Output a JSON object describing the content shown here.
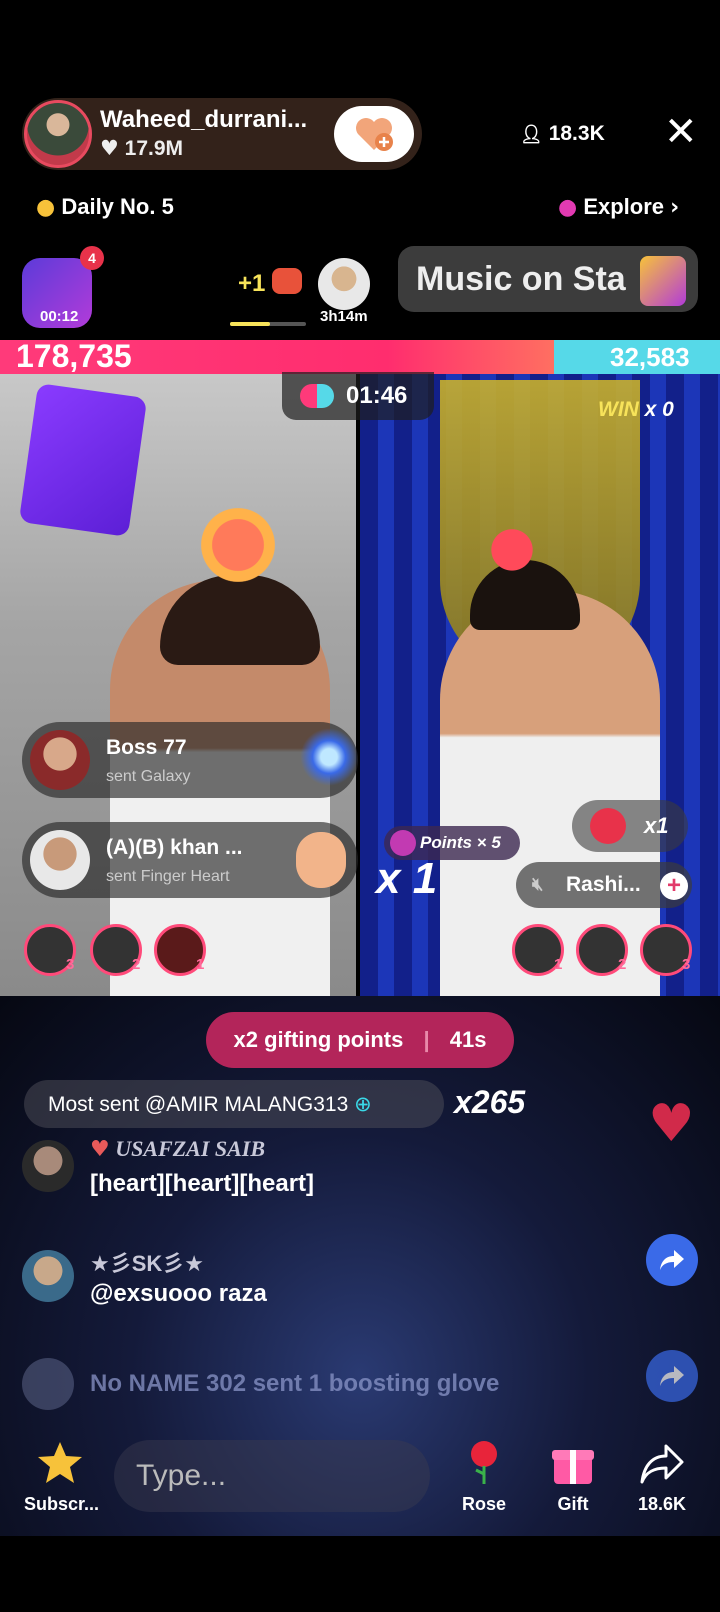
{
  "host": {
    "name": "Waheed_durrani...",
    "likes": "17.9M",
    "viewers": "18.3K"
  },
  "badges": {
    "daily": "Daily No. 5",
    "explore": "Explore"
  },
  "boost": {
    "badge": "4",
    "timer": "00:12"
  },
  "guest": {
    "plus": "+1",
    "timer": "3h14m"
  },
  "music_banner": "Music on Sta",
  "battle": {
    "score_left": "178,735",
    "score_right": "32,583",
    "timer": "01:46",
    "win_label": "WIN",
    "win_count": "x 0",
    "left_share": 0.77
  },
  "gift_toasts": [
    {
      "name": "Boss 77",
      "sub": "sent Galaxy"
    },
    {
      "name": "(A)(B) khan ...",
      "sub": "sent Finger Heart"
    }
  ],
  "left_fans": [
    "3",
    "2",
    "1"
  ],
  "right_fans": [
    "1",
    "2",
    "3"
  ],
  "right_panel": {
    "points": "Points × 5",
    "multiplier_big": "x 1",
    "multiplier_small": "x1",
    "cohost": "Rashi...",
    "plus": "+"
  },
  "gifting": {
    "label": "x2 gifting points",
    "seconds": "41s"
  },
  "most_sent": {
    "text": "Most sent @AMIR MALANG313",
    "count": "x265"
  },
  "chat": [
    {
      "name": "USAFZAI SAIB",
      "msg": "[heart][heart][heart]"
    },
    {
      "name": "★彡SK彡★",
      "msg": "@exsuooo raza"
    }
  ],
  "system_msg": "No NAME 302 sent 1 boosting glove",
  "toolbar": {
    "subscribe": "Subscr...",
    "type_placeholder": "Type...",
    "rose": "Rose",
    "gift": "Gift",
    "share": "18.6K"
  },
  "colors": {
    "accent_pink": "#ff2d6e",
    "accent_cyan": "#56d9e8",
    "gifting_bg": "#b3255a",
    "share_blue": "#3a6ae8"
  }
}
